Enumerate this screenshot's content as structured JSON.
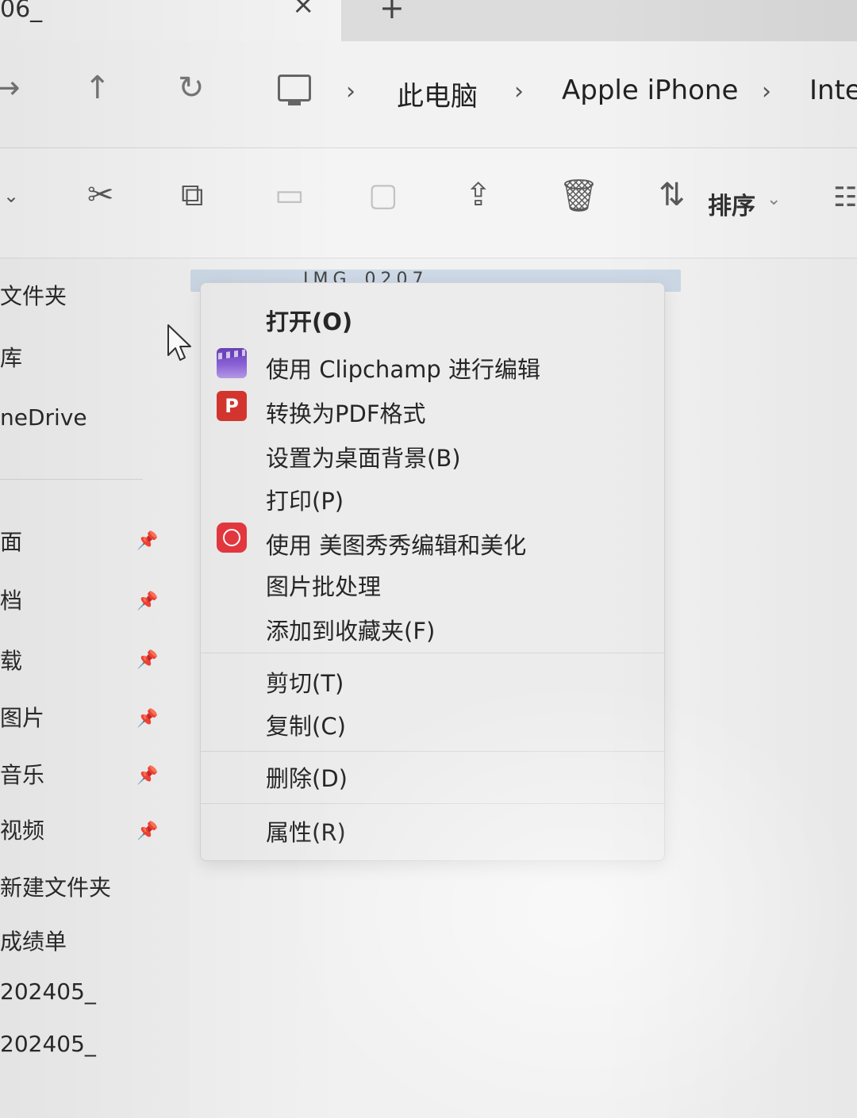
{
  "tabbar": {
    "tab_title": "06_",
    "close_glyph": "×",
    "new_tab_glyph": "+"
  },
  "nav": {
    "forward_glyph": "→",
    "up_glyph": "↑",
    "refresh_glyph": "↻",
    "breadcrumbs": [
      "此电脑",
      "Apple iPhone",
      "Inte"
    ],
    "separator": "›"
  },
  "toolbar": {
    "sort_label": "排序",
    "sort_chevron": "⌄",
    "icons": [
      "chevron-down-icon",
      "cut-icon",
      "copy-icon",
      "paste-icon",
      "rename-icon",
      "share-icon",
      "delete-icon",
      "sort-icon",
      "view-icon"
    ]
  },
  "sidebar": {
    "items": [
      "文件夹",
      "库",
      "neDrive",
      "面",
      "档",
      "载",
      "图片",
      "音乐",
      "视频",
      "新建文件夹",
      "成绩单",
      "202405_",
      "202405_"
    ]
  },
  "content": {
    "selected_file": "IMG_0207"
  },
  "context_menu": {
    "items": [
      {
        "label": "打开(O)",
        "icon": null
      },
      {
        "label": "使用 Clipchamp 进行编辑",
        "icon": "clipchamp-icon"
      },
      {
        "label": "转换为PDF格式",
        "icon": "pdf-convert-icon"
      },
      {
        "label": "设置为桌面背景(B)",
        "icon": null
      },
      {
        "label": "打印(P)",
        "icon": null
      },
      {
        "label": "使用 美图秀秀编辑和美化",
        "icon": "meitu-icon"
      },
      {
        "label": "图片批处理",
        "icon": null
      },
      {
        "label": "添加到收藏夹(F)",
        "icon": null
      },
      {
        "label": "剪切(T)",
        "icon": null
      },
      {
        "label": "复制(C)",
        "icon": null
      },
      {
        "label": "删除(D)",
        "icon": null
      },
      {
        "label": "属性(R)",
        "icon": null
      }
    ],
    "pdf_icon_text": "P"
  }
}
